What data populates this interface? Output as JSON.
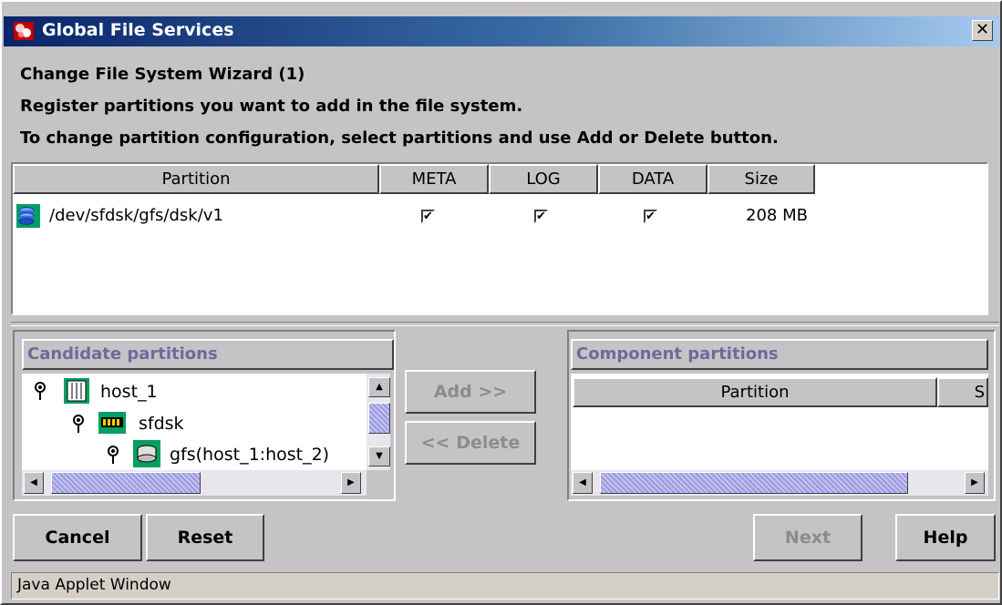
{
  "window": {
    "title": "Global File Services",
    "close_glyph": "✕"
  },
  "wizard": {
    "title": "Change File System Wizard (1)",
    "line1": "Register partitions you want to add in the file system.",
    "line2": "To change partition configuration, select partitions and use Add or Delete button."
  },
  "partition_table": {
    "headers": [
      "Partition",
      "META",
      "LOG",
      "DATA",
      "Size"
    ],
    "rows": [
      {
        "partition": "/dev/sfdsk/gfs/dsk/v1",
        "meta": true,
        "log": true,
        "data": true,
        "size": "208 MB",
        "icon": "disk-volume-icon"
      }
    ]
  },
  "candidate": {
    "header": "Candidate partitions",
    "tree": [
      {
        "label": "host_1",
        "icon": "host-icon"
      },
      {
        "label": "sfdsk",
        "icon": "memory-icon"
      },
      {
        "label": "gfs(host_1:host_2)",
        "icon": "disk-icon"
      }
    ]
  },
  "component": {
    "header": "Component partitions",
    "columns": [
      "Partition",
      "S"
    ]
  },
  "buttons": {
    "add": "Add >>",
    "delete": "<< Delete",
    "cancel": "Cancel",
    "reset": "Reset",
    "next": "Next",
    "help": "Help"
  },
  "status_bar": "Java Applet Window",
  "colors": {
    "title_gradient_start": "#0a246a",
    "title_gradient_end": "#a6caf0",
    "section_header_text": "#6b6b9b",
    "background": "#c6c3c6"
  }
}
